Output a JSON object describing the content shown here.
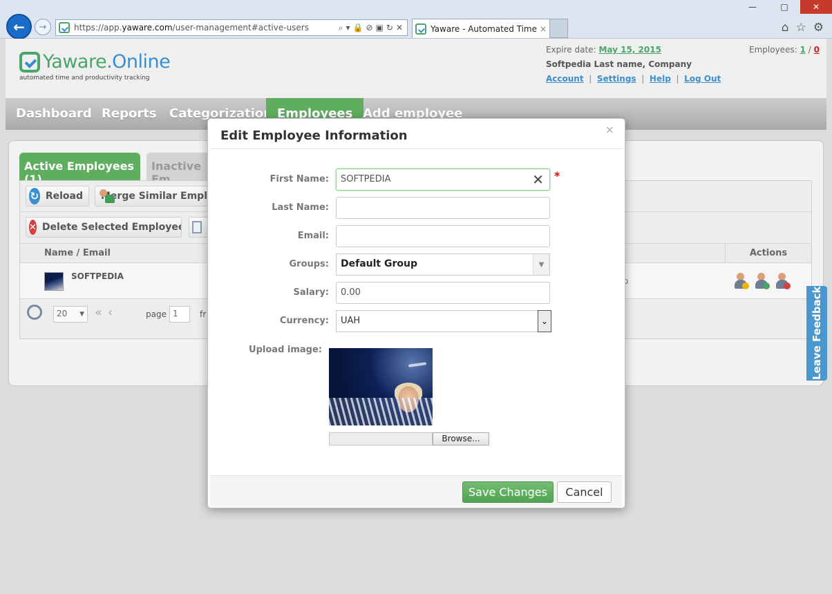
{
  "browser": {
    "url_prefix": "https://app.",
    "url_domain": "yaware.com",
    "url_path": "/user-management#active-users",
    "tab_title": "Yaware - Automated Time ...",
    "tab_close": "×",
    "back": "←",
    "forward": "→",
    "window": {
      "minimize": "—",
      "maximize": "□",
      "close": "✕"
    }
  },
  "header": {
    "logo_part1": "Yaware",
    "logo_part2": ".Online",
    "tagline": "automated time and productivity tracking",
    "expire_label": "Expire date:",
    "expire_date": "May 15, 2015",
    "user_line": "Softpedia Last name, Company",
    "links": {
      "account": "Account",
      "settings": "Settings",
      "help": "Help",
      "logout": "Log Out",
      "sep": "|"
    },
    "employees_label": "Employees:",
    "employees_active": "1",
    "employees_sep": "/",
    "employees_inactive": "0"
  },
  "nav": {
    "dashboard": "Dashboard",
    "reports": "Reports",
    "categorization": "Categorization",
    "employees": "Employees",
    "add_employee": "Add employee"
  },
  "subtabs": {
    "active": "Active Employees (1)",
    "inactive": "Inactive Em"
  },
  "toolbar": {
    "reload": "Reload",
    "merge": "Merge Similar Empl",
    "delete": "Delete Selected Employees"
  },
  "grid": {
    "col_name": "Name / Email",
    "col_actions": "Actions",
    "row_name": "SOFTPEDIA",
    "row_fragment": "o"
  },
  "pager": {
    "page_size": "20",
    "page_label": "page",
    "page_value": "1",
    "from_fragment": "fr"
  },
  "feedback": "Leave Feedback",
  "modal": {
    "title": "Edit Employee Information",
    "close": "×",
    "first_name_label": "First Name:",
    "first_name_value": "SOFTPEDIA",
    "required_mark": "*",
    "last_name_label": "Last Name:",
    "last_name_value": "",
    "email_label": "Email:",
    "email_value": "",
    "groups_label": "Groups:",
    "groups_value": "Default Group",
    "salary_label": "Salary:",
    "salary_value": "0.00",
    "currency_label": "Currency:",
    "currency_value": "UAH",
    "upload_label": "Upload image:",
    "browse": "Browse...",
    "save": "Save Changes",
    "cancel": "Cancel"
  },
  "colors": {
    "accent_green": "#5fae5f",
    "link_blue": "#3a8fd0",
    "warning_red": "#d02020"
  }
}
